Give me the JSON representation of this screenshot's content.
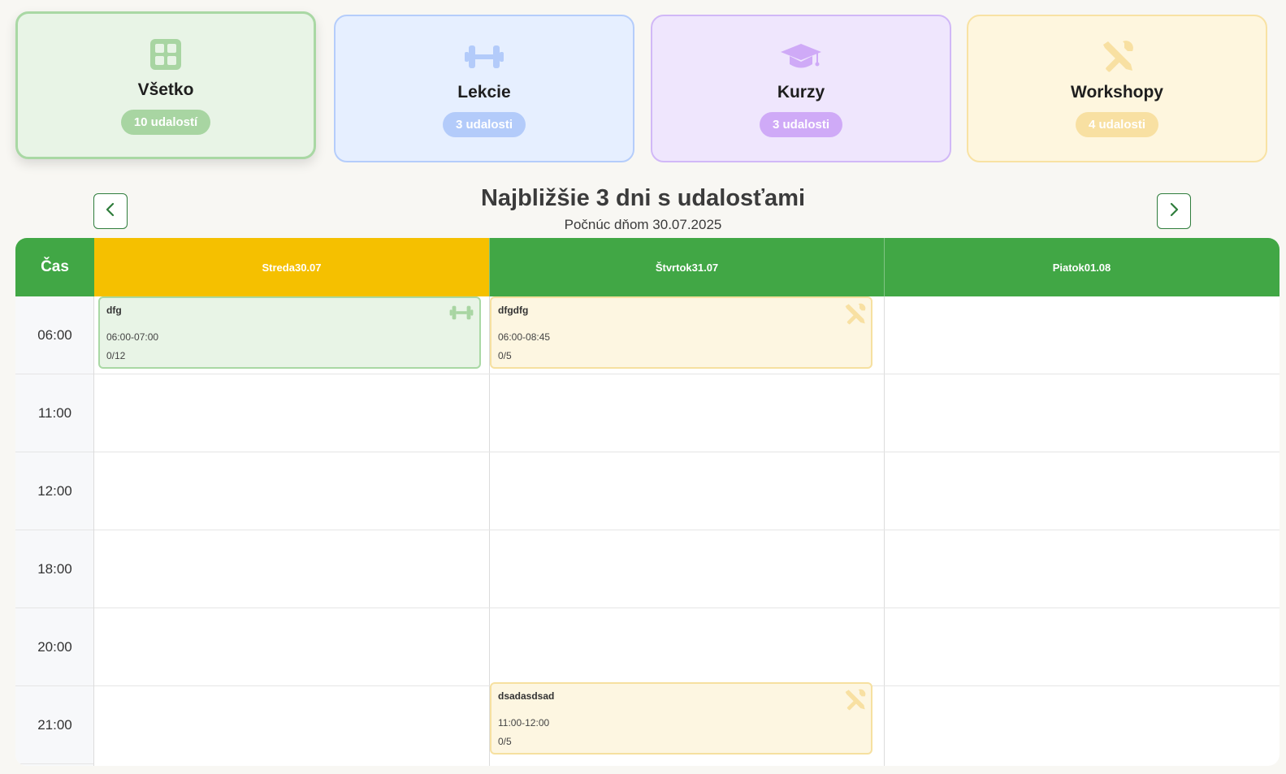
{
  "colors": {
    "header_green": "#41a745",
    "today_yellow": "#f5c000",
    "nav_green": "#2f7d3c"
  },
  "categories": [
    {
      "key": "all",
      "icon": "grid-icon",
      "label": "Všetko",
      "count": "10 udalostí",
      "active": true
    },
    {
      "key": "lekcie",
      "icon": "dumbbell-icon",
      "label": "Lekcie",
      "count": "3 udalosti",
      "active": false
    },
    {
      "key": "kurzy",
      "icon": "graduation-cap-icon",
      "label": "Kurzy",
      "count": "3 udalosti",
      "active": false
    },
    {
      "key": "workshopy",
      "icon": "tools-icon",
      "label": "Workshopy",
      "count": "4 udalosti",
      "active": false
    }
  ],
  "header": {
    "title": "Najbližšie 3 dni s udalosťami",
    "subtitle": "Počnúc dňom 30.07.2025",
    "prev_icon": "chevron-left-icon",
    "next_icon": "chevron-right-icon"
  },
  "calendar": {
    "time_header": "Čas",
    "days": [
      {
        "label": "Streda30.07",
        "today": true
      },
      {
        "label": "Štvrtok31.07",
        "today": false
      },
      {
        "label": "Piatok01.08",
        "today": false
      }
    ],
    "times": [
      "06:00",
      "11:00",
      "12:00",
      "18:00",
      "20:00",
      "21:00"
    ],
    "events": [
      {
        "title": "dfg",
        "time": "06:00-07:00",
        "capacity": "0/12",
        "type": "lekcia",
        "icon": "dumbbell-icon"
      },
      {
        "title": "dfgdfg",
        "time": "06:00-08:45",
        "capacity": "0/5",
        "type": "workshop",
        "icon": "tools-icon"
      },
      {
        "title": "dsadasdsad",
        "time": "11:00-12:00",
        "capacity": "0/5",
        "type": "workshop",
        "icon": "tools-icon"
      }
    ]
  }
}
